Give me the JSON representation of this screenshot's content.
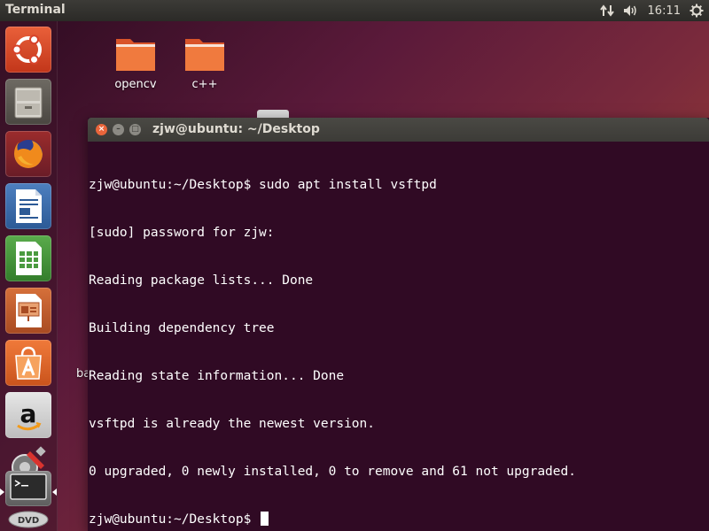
{
  "panel": {
    "app_title": "Terminal",
    "clock": "16:11",
    "icons": [
      "network-icon",
      "volume-icon",
      "settings-gear-icon"
    ]
  },
  "launcher": {
    "items": [
      {
        "name": "ubuntu-dash-icon"
      },
      {
        "name": "files-icon"
      },
      {
        "name": "firefox-icon"
      },
      {
        "name": "libreoffice-writer-icon"
      },
      {
        "name": "libreoffice-calc-icon"
      },
      {
        "name": "libreoffice-impress-icon"
      },
      {
        "name": "software-center-icon"
      },
      {
        "name": "amazon-icon"
      },
      {
        "name": "system-settings-icon"
      },
      {
        "name": "terminal-icon"
      },
      {
        "name": "dvd-icon"
      }
    ]
  },
  "desktop": {
    "icons": [
      {
        "label": "opencv"
      },
      {
        "label": "c++"
      }
    ],
    "partial_label": "ba"
  },
  "terminal": {
    "title": "zjw@ubuntu: ~/Desktop",
    "lines": [
      "zjw@ubuntu:~/Desktop$ sudo apt install vsftpd",
      "[sudo] password for zjw:",
      "Reading package lists... Done",
      "Building dependency tree",
      "Reading state information... Done",
      "vsftpd is already the newest version.",
      "0 upgraded, 0 newly installed, 0 to remove and 61 not upgraded.",
      "zjw@ubuntu:~/Desktop$ "
    ]
  },
  "colors": {
    "terminal_bg": "#300a24",
    "panel_bg": "#3c3b37",
    "close_button": "#e9653b",
    "accent_orange": "#e95420"
  }
}
